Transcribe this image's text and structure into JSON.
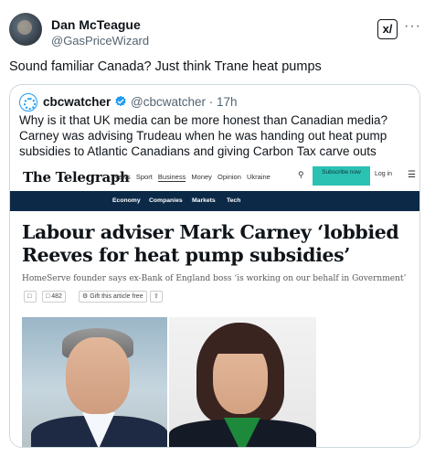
{
  "tweet": {
    "author_name": "Dan McTeague",
    "author_handle": "@GasPriceWizard",
    "grok_label": "x/",
    "more_label": "···",
    "text": "Sound familiar Canada? Just think Trane  heat pumps"
  },
  "quoted_tweet": {
    "author_name": "cbcwatcher",
    "author_handle": "@cbcwatcher · 17h",
    "verified_color": "#1d9bf0",
    "text": "Why is it that UK media can be more honest than Canadian media?  Carney was advising Trudeau when he was handing out heat pump subsidies to Atlantic Canadians and giving Carbon Tax carve outs @MarkJCarney"
  },
  "article": {
    "logo": "The Telegraph",
    "nav": [
      "News",
      "Sport",
      "Business",
      "Money",
      "Opinion",
      "Ukraine"
    ],
    "active_nav": "Business",
    "subscribe_label": "Subscribe now",
    "login_label": "Log in",
    "subnav": [
      "Economy",
      "Companies",
      "Markets",
      "Tech"
    ],
    "headline": "Labour adviser Mark Carney ‘lobbied Reeves for heat pump subsidies’",
    "standfirst": "HomeServe founder says ex-Bank of England boss ‘is working on our behalf in Government’",
    "comment_count": "482",
    "gift_label": "Gift this article free",
    "brand_color": "#0c2a48",
    "subscribe_color": "#2bc1b3"
  }
}
